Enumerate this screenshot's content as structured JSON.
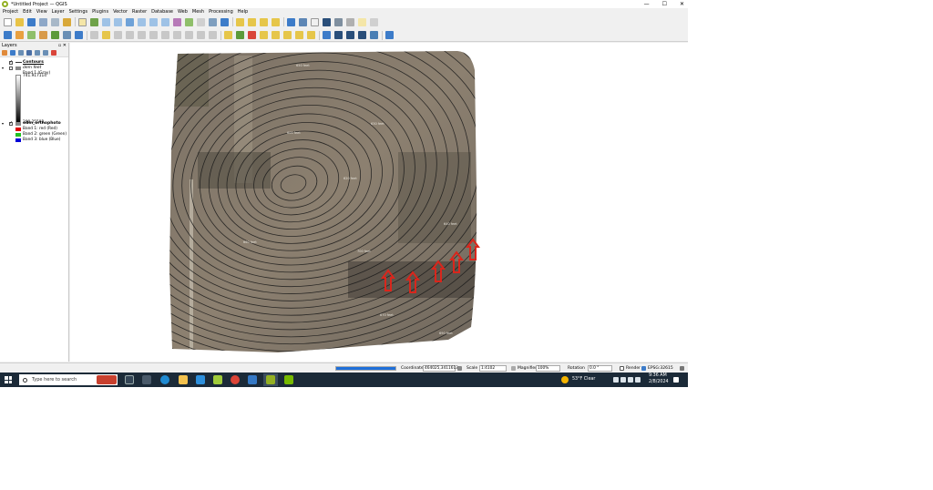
{
  "window": {
    "title": "*Untitled Project — QGIS",
    "controls": [
      "—",
      "☐",
      "✕"
    ]
  },
  "menu": [
    "Project",
    "Edit",
    "View",
    "Layer",
    "Settings",
    "Plugins",
    "Vector",
    "Raster",
    "Database",
    "Web",
    "Mesh",
    "Processing",
    "Help"
  ],
  "layers_panel": {
    "title": "Layers",
    "controls": "▫ ✕",
    "layers": [
      {
        "name": "Contours",
        "checked": true
      },
      {
        "name": "dem feet",
        "checked": false
      },
      {
        "band_label": "Band 1 (Gray)",
        "max": "741.917114",
        "min": "290.25592"
      },
      {
        "name": "odm_orthophoto",
        "checked": true
      },
      {
        "bands": [
          "Band 1: red (Red)",
          "Band 2: green (Green)",
          "Band 3: blue (Blue)"
        ]
      }
    ],
    "band_colors": [
      "#e00000",
      "#22c022",
      "#0000d8"
    ]
  },
  "locator": {
    "placeholder": "Type to locate (Ctrl+K)"
  },
  "status": {
    "progress": 100,
    "coordinate_label": "Coordinate",
    "coordinate_value": "464025,3411613",
    "scale_label": "Scale",
    "scale_value": "1:4102",
    "magnifier_label": "Magnifier",
    "magnifier_value": "100%",
    "rotation_label": "Rotation",
    "rotation_value": "0.0 °",
    "render_label": "Render",
    "crs": "EPSG:32615"
  },
  "map": {
    "contour_labels": [
      "650 feet",
      "600 feet",
      "700 feet",
      "670 feet",
      "690 feet",
      "630 feet",
      "620 feet",
      "640 feet",
      "660 feet"
    ],
    "arrow_color": "#d9261c",
    "arrow_count": 5
  },
  "taskbar": {
    "search_placeholder": "Type here to search",
    "weather": "53°F  Clear",
    "time": "9:36 AM",
    "date": "2/8/2024"
  }
}
